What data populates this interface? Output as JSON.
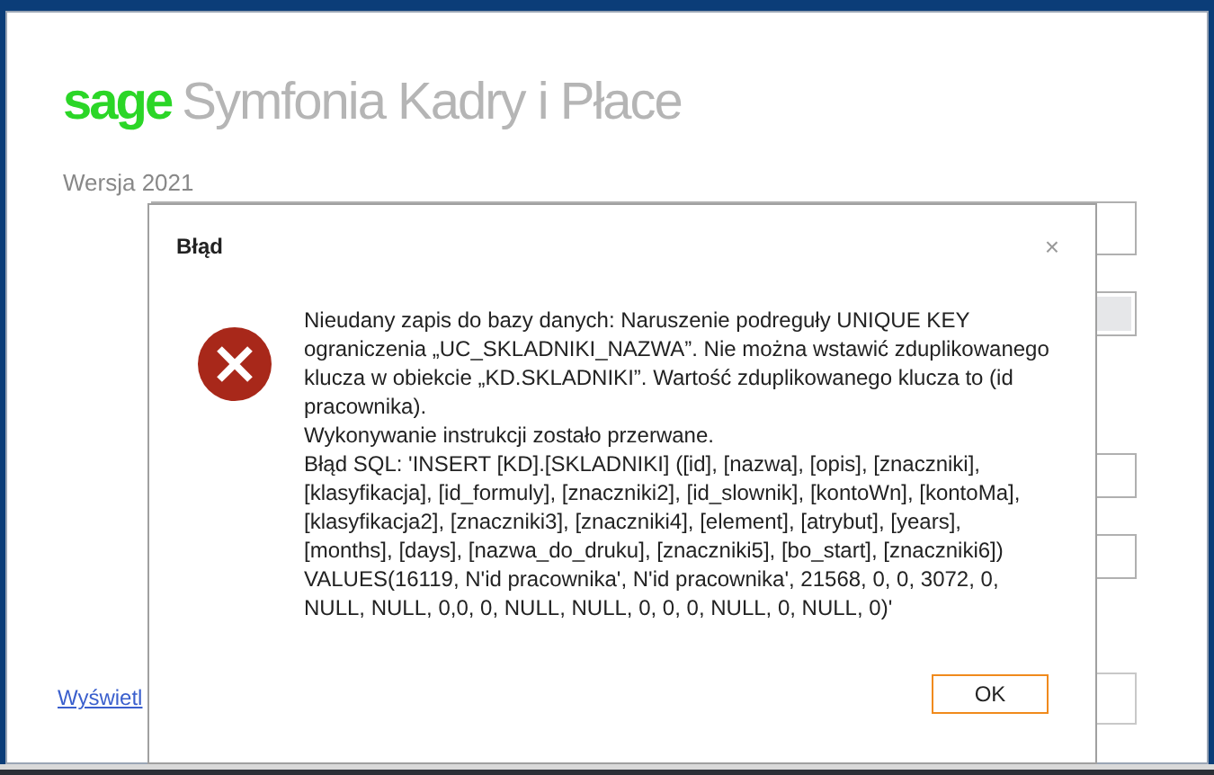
{
  "app": {
    "brand": "sage",
    "product": "Symfonia Kadry i Płace",
    "version": "Wersja 2021",
    "link": "Wyświetl"
  },
  "dialog": {
    "title": "Błąd",
    "close": "×",
    "paragraphs": [
      "Nieudany zapis do bazy danych: Naruszenie podreguły UNIQUE KEY ograniczenia „UC_SKLADNIKI_NAZWA”. Nie można wstawić zduplikowanego klucza w obiekcie „KD.SKLADNIKI”. Wartość zduplikowanego klucza to (id pracownika).",
      "Wykonywanie instrukcji zostało przerwane.",
      "Błąd SQL: 'INSERT [KD].[SKLADNIKI] ([id], [nazwa], [opis], [znaczniki], [klasyfikacja], [id_formuly], [znaczniki2], [id_slownik], [kontoWn], [kontoMa], [klasyfikacja2], [znaczniki3], [znaczniki4], [element], [atrybut], [years], [months], [days], [nazwa_do_druku], [znaczniki5], [bo_start], [znaczniki6]) VALUES(16119, N'id pracownika', N'id pracownika', 21568, 0, 0, 3072, 0, NULL, NULL, 0,0, 0, NULL, NULL, 0, 0, 0, NULL, 0, NULL, 0)'"
    ],
    "ok": "OK"
  }
}
